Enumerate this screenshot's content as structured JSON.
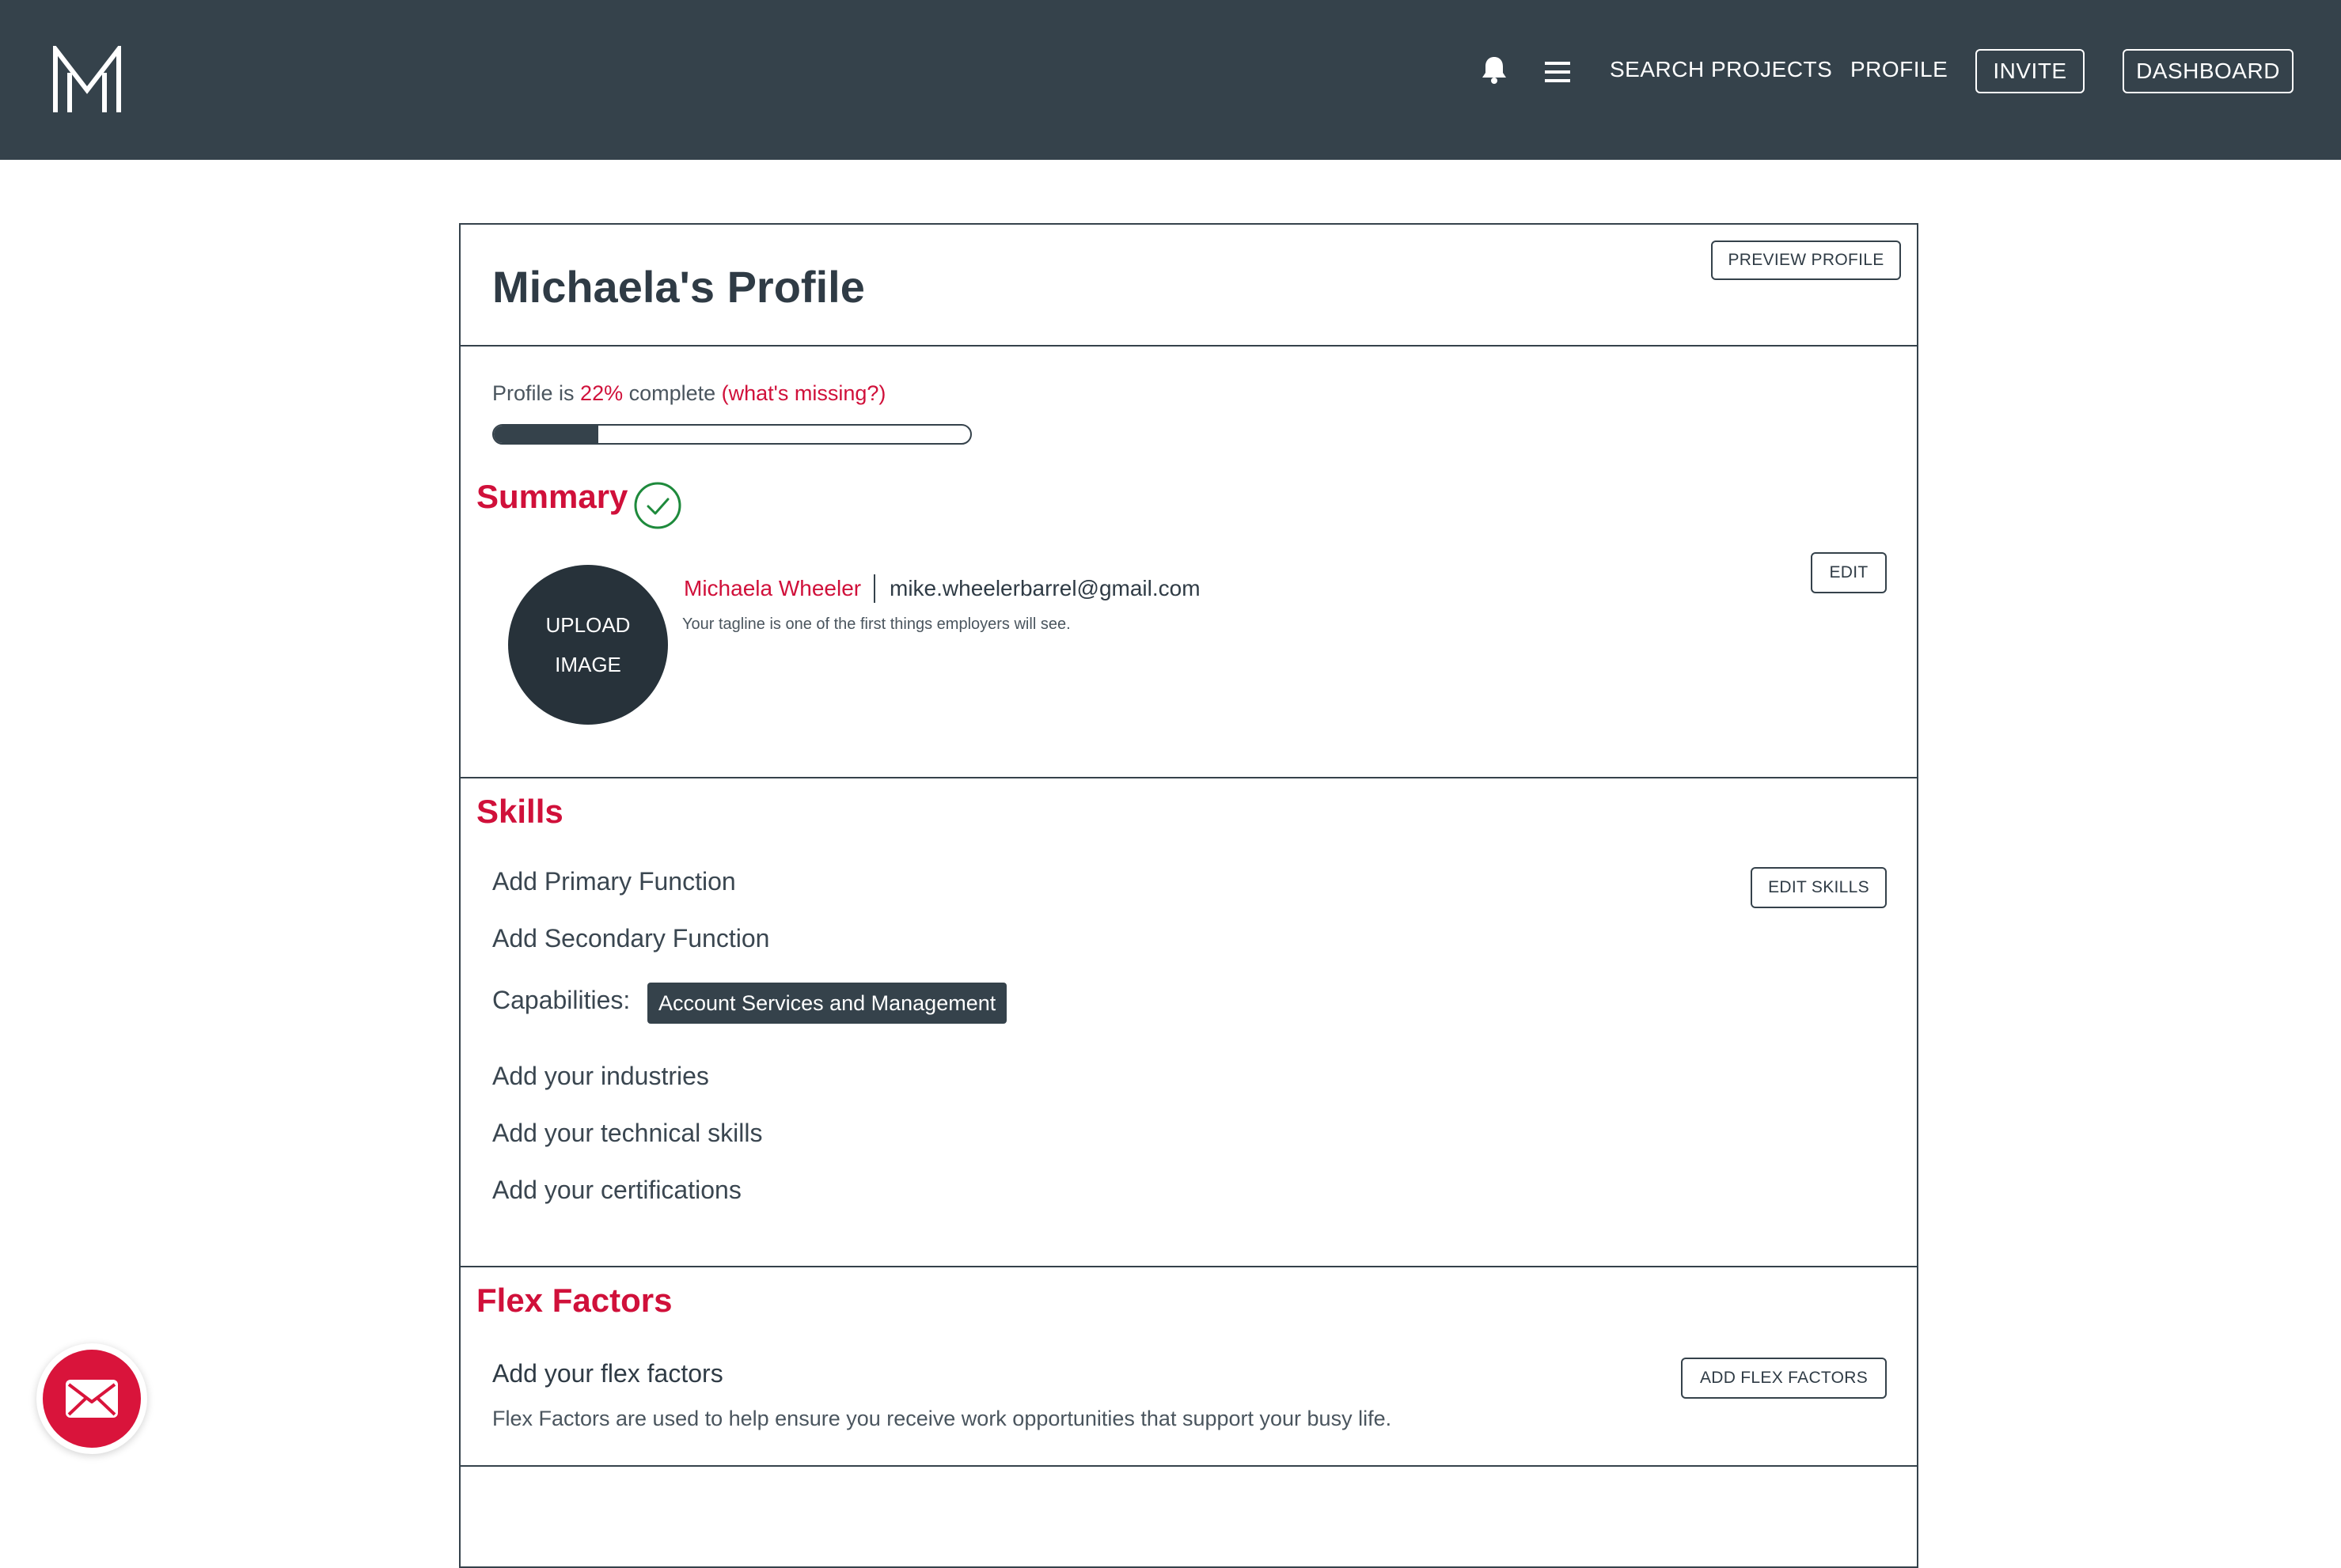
{
  "colors": {
    "nav_bg": "#35424b",
    "accent_red": "#d0103a",
    "text_dark": "#2f3b45",
    "fab_red": "#d9143b"
  },
  "header": {
    "logo_icon": "m-logo-icon",
    "bell_icon": "bell-icon",
    "menu_icon": "hamburger-menu-icon",
    "nav": {
      "search_projects": "SEARCH PROJECTS",
      "profile": "PROFILE",
      "invite": "INVITE",
      "dashboard": "DASHBOARD"
    }
  },
  "profile": {
    "title": "Michaela's Profile",
    "preview_button": "PREVIEW PROFILE",
    "progress": {
      "prefix": "Profile is ",
      "percent_text": "22%",
      "suffix": " complete ",
      "missing_link": "(what's missing?)",
      "value": 0.22
    }
  },
  "summary": {
    "title": "Summary",
    "status_icon": "check-circle-icon",
    "upload_line1": "UPLOAD",
    "upload_line2": "IMAGE",
    "name": "Michaela Wheeler",
    "email": "mike.wheelerbarrel@gmail.com",
    "tagline": "Your tagline is one of the first things employers will see.",
    "edit_button": "EDIT"
  },
  "skills": {
    "title": "Skills",
    "primary": "Add Primary Function",
    "secondary": "Add Secondary Function",
    "capabilities_label": "Capabilities:",
    "capabilities": [
      "Account Services and Management"
    ],
    "industries": "Add your industries",
    "technical": "Add your technical skills",
    "certifications": "Add your certifications",
    "edit_button": "EDIT SKILLS"
  },
  "flex": {
    "title": "Flex Factors",
    "subtitle": "Add your flex factors",
    "description": "Flex Factors are used to help ensure you receive work opportunities that support your busy life.",
    "add_button": "ADD FLEX FACTORS"
  },
  "fab": {
    "icon": "mail-icon"
  }
}
